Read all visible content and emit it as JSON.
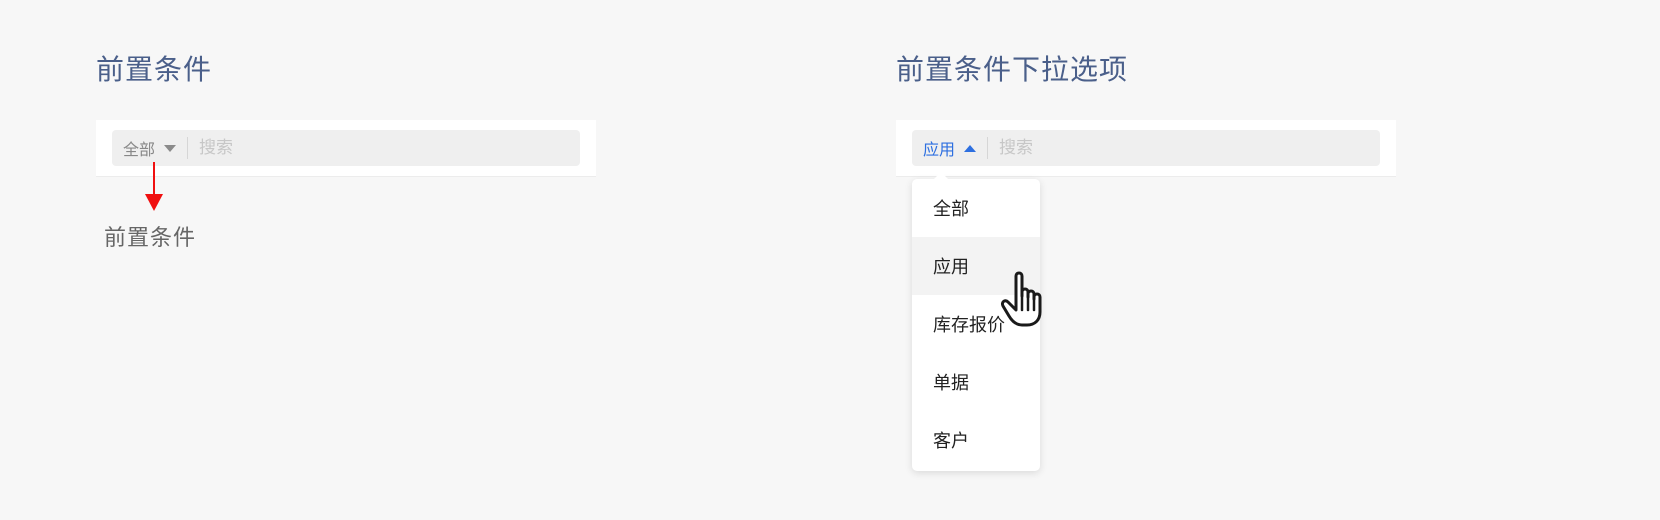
{
  "left": {
    "title": "前置条件",
    "filter": {
      "prefix_label": "全部",
      "search_placeholder": "搜索"
    },
    "annotation_label": "前置条件"
  },
  "right": {
    "title": "前置条件下拉选项",
    "filter": {
      "prefix_label": "应用",
      "search_placeholder": "搜索"
    },
    "dropdown": {
      "options": [
        "全部",
        "应用",
        "库存报价",
        "单据",
        "客户"
      ],
      "hovered_option": "应用"
    }
  },
  "colors": {
    "title": "#4a5f8a",
    "active_prefix": "#2d6fe0",
    "annotation_arrow": "#f01010",
    "background": "#f7f7f7"
  },
  "icons": {
    "collapsed_caret": "caret-down-icon",
    "expanded_caret": "caret-up-icon",
    "pointer": "hand-pointer-icon"
  }
}
